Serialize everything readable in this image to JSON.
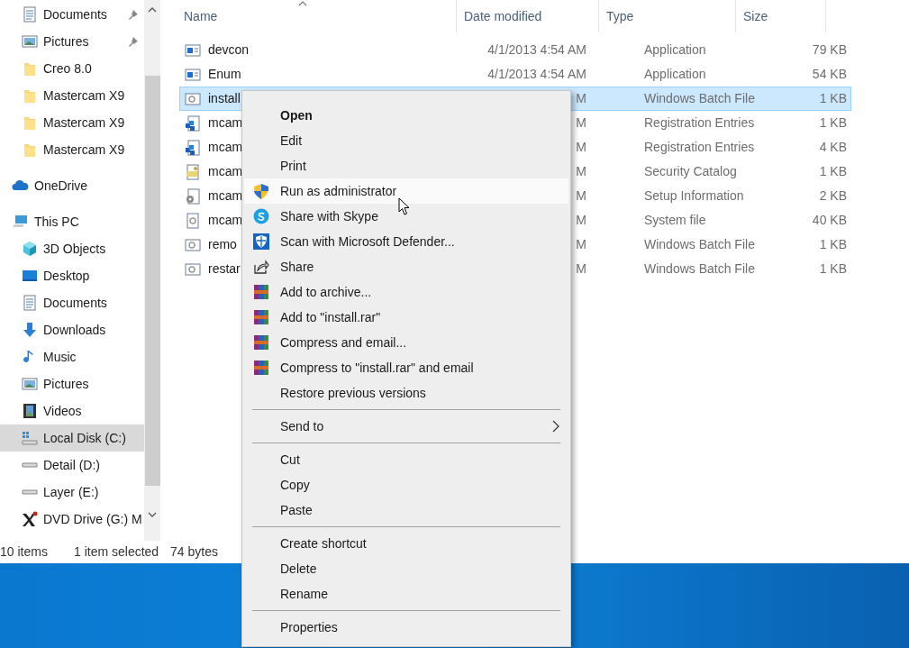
{
  "sidebar": {
    "quick_access": [
      {
        "label": "Documents",
        "kind": "document",
        "pinned": true
      },
      {
        "label": "Pictures",
        "kind": "picture",
        "pinned": true
      },
      {
        "label": "Creo 8.0",
        "kind": "folder",
        "pinned": false
      },
      {
        "label": "Mastercam X9",
        "kind": "folder",
        "pinned": false
      },
      {
        "label": "Mastercam X9",
        "kind": "folder",
        "pinned": false
      },
      {
        "label": "Mastercam X9",
        "kind": "folder",
        "pinned": false
      }
    ],
    "tree": [
      {
        "label": "OneDrive",
        "kind": "cloud",
        "selected": false
      },
      {
        "label": "This PC",
        "kind": "pc",
        "selected": false,
        "children": [
          {
            "label": "3D Objects",
            "kind": "cube",
            "selected": false
          },
          {
            "label": "Desktop",
            "kind": "desktop",
            "selected": false
          },
          {
            "label": "Documents",
            "kind": "document",
            "selected": false
          },
          {
            "label": "Downloads",
            "kind": "download",
            "selected": false
          },
          {
            "label": "Music",
            "kind": "music",
            "selected": false
          },
          {
            "label": "Pictures",
            "kind": "picture",
            "selected": false
          },
          {
            "label": "Videos",
            "kind": "video",
            "selected": false
          },
          {
            "label": "Local Disk (C:)",
            "kind": "system-drive",
            "selected": true
          },
          {
            "label": "Detail (D:)",
            "kind": "drive",
            "selected": false
          },
          {
            "label": "Layer (E:)",
            "kind": "drive",
            "selected": false
          },
          {
            "label": "DVD Drive (G:) M",
            "kind": "dvd",
            "selected": false
          }
        ]
      }
    ]
  },
  "table": {
    "columns": [
      "Name",
      "Date modified",
      "Type",
      "Size"
    ],
    "rows": [
      {
        "kind": "app",
        "name": "devcon",
        "date": "4/1/2013 4:54 AM",
        "type": "Application",
        "size": "79 KB",
        "selected": false
      },
      {
        "kind": "app",
        "name": "Enum",
        "date": "4/1/2013 4:54 AM",
        "type": "Application",
        "size": "54 KB",
        "selected": false
      },
      {
        "kind": "batch",
        "name": "install",
        "date": "M",
        "type": "Windows Batch File",
        "size": "1 KB",
        "selected": true
      },
      {
        "kind": "reg",
        "name": "mcam",
        "date": "M",
        "type": "Registration Entries",
        "size": "1 KB",
        "selected": false
      },
      {
        "kind": "reg",
        "name": "mcam",
        "date": "M",
        "type": "Registration Entries",
        "size": "4 KB",
        "selected": false
      },
      {
        "kind": "cat",
        "name": "mcam",
        "date": "M",
        "type": "Security Catalog",
        "size": "1 KB",
        "selected": false
      },
      {
        "kind": "inf",
        "name": "mcam",
        "date": "M",
        "type": "Setup Information",
        "size": "2 KB",
        "selected": false
      },
      {
        "kind": "sys",
        "name": "mcam",
        "date": "M",
        "type": "System file",
        "size": "40 KB",
        "selected": false
      },
      {
        "kind": "batch",
        "name": "remo",
        "date": "M",
        "type": "Windows Batch File",
        "size": "1 KB",
        "selected": false
      },
      {
        "kind": "batch",
        "name": "restar",
        "date": "M",
        "type": "Windows Batch File",
        "size": "1 KB",
        "selected": false
      }
    ]
  },
  "status_bar": {
    "item_count": "10 items",
    "selection": "1 item selected",
    "selection_size": "74 bytes"
  },
  "context_menu": {
    "groups": [
      [
        {
          "label": "Open",
          "default": true,
          "selected": false,
          "submenu": false
        },
        {
          "label": "Edit",
          "default": false,
          "selected": false,
          "submenu": false
        },
        {
          "label": "Print",
          "default": false,
          "selected": false,
          "submenu": false
        },
        {
          "label": "Run as administrator",
          "kind": "shield",
          "default": false,
          "selected": true,
          "submenu": false
        },
        {
          "label": "Share with Skype",
          "kind": "skype",
          "default": false,
          "selected": false,
          "submenu": false
        },
        {
          "label": "Scan with Microsoft Defender...",
          "kind": "defender",
          "default": false,
          "selected": false,
          "submenu": false
        },
        {
          "label": "Share",
          "kind": "share",
          "default": false,
          "selected": false,
          "submenu": false
        },
        {
          "label": "Add to archive...",
          "kind": "archive",
          "default": false,
          "selected": false,
          "submenu": false
        },
        {
          "label": "Add to \"install.rar\"",
          "kind": "archive",
          "default": false,
          "selected": false,
          "submenu": false
        },
        {
          "label": "Compress and email...",
          "kind": "archive",
          "default": false,
          "selected": false,
          "submenu": false
        },
        {
          "label": "Compress to \"install.rar\" and email",
          "kind": "archive",
          "default": false,
          "selected": false,
          "submenu": false
        },
        {
          "label": "Restore previous versions",
          "default": false,
          "selected": false,
          "submenu": false
        }
      ],
      [
        {
          "label": "Send to",
          "default": false,
          "selected": false,
          "submenu": true
        }
      ],
      [
        {
          "label": "Cut",
          "default": false,
          "selected": false,
          "submenu": false
        },
        {
          "label": "Copy",
          "default": false,
          "selected": false,
          "submenu": false
        },
        {
          "label": "Paste",
          "default": false,
          "selected": false,
          "submenu": false
        }
      ],
      [
        {
          "label": "Create shortcut",
          "default": false,
          "selected": false,
          "submenu": false
        },
        {
          "label": "Delete",
          "default": false,
          "selected": false,
          "submenu": false
        },
        {
          "label": "Rename",
          "default": false,
          "selected": false,
          "submenu": false
        }
      ],
      [
        {
          "label": "Properties",
          "default": false,
          "selected": false,
          "submenu": false
        }
      ]
    ]
  }
}
